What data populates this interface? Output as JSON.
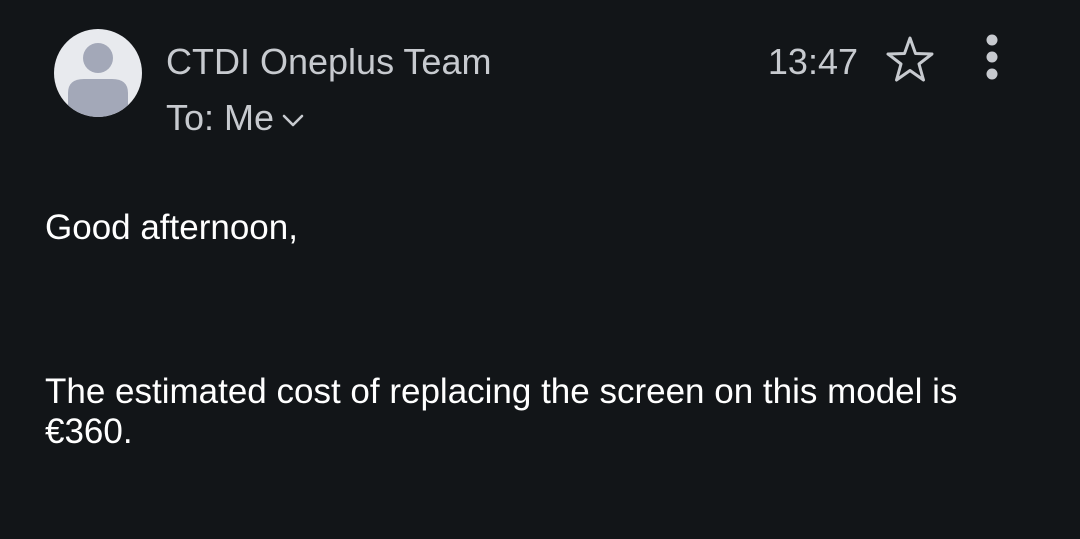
{
  "email": {
    "sender": "CTDI Oneplus Team",
    "recipient_label": "To: Me",
    "time": "13:47",
    "greeting": "Good afternoon,",
    "body": "The estimated cost of replacing the screen on this model is €360."
  },
  "icons": {
    "avatar": "default-avatar-icon",
    "star": "star-outline-icon",
    "more": "more-vertical-icon",
    "chevron": "chevron-down-icon"
  },
  "colors": {
    "background": "#121518",
    "text_primary": "#ffffff",
    "text_secondary": "#c7cacf",
    "avatar_bg": "#e8eaee",
    "avatar_fg": "#a3a8b8"
  }
}
